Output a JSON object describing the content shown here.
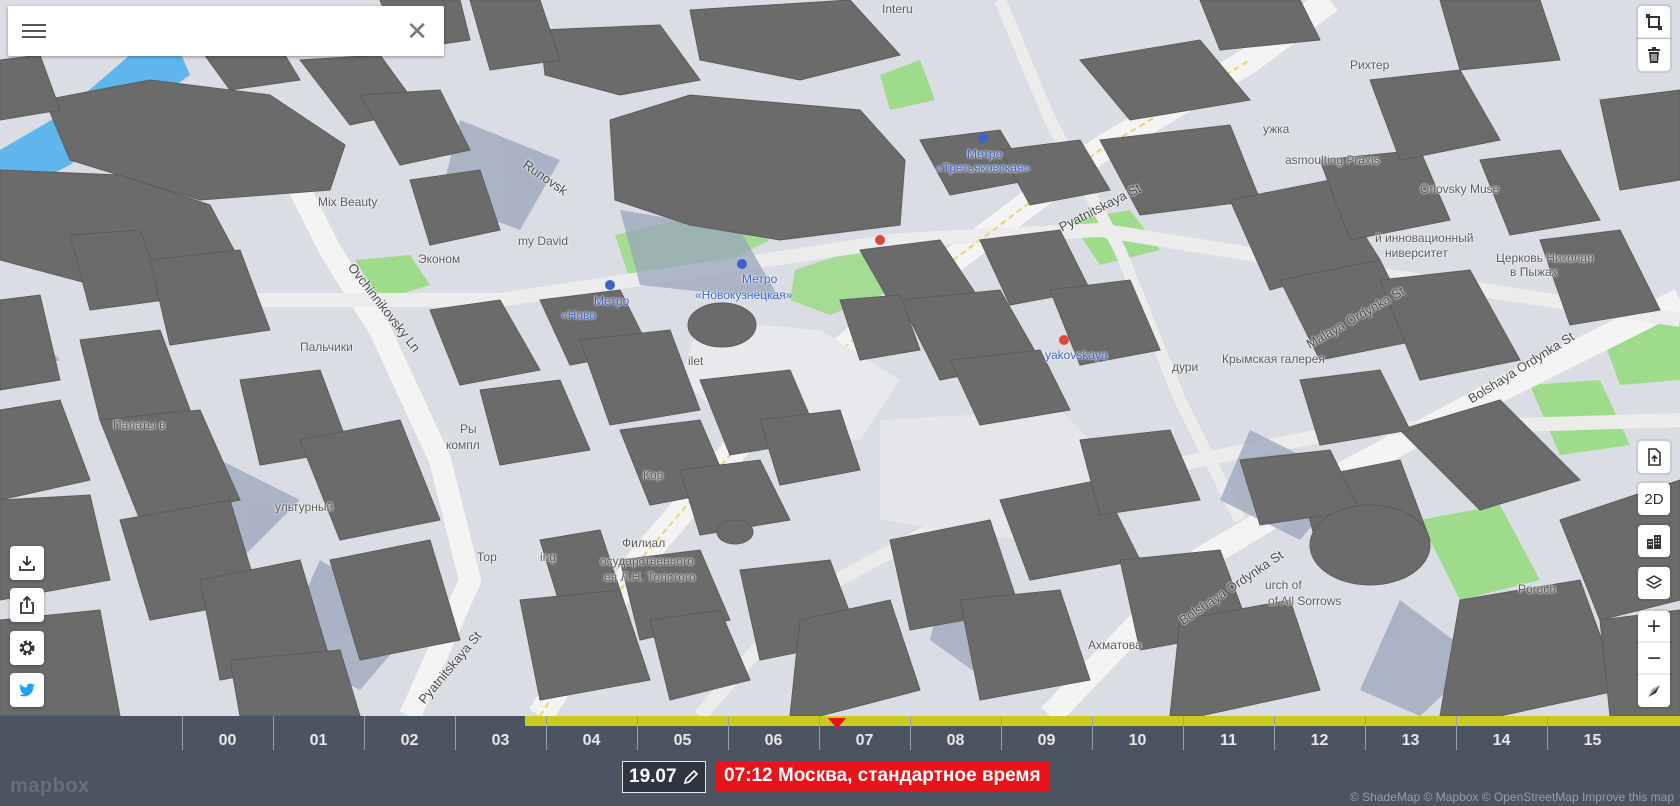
{
  "search": {
    "value": "",
    "placeholder": ""
  },
  "map_labels": {
    "metro": "Метро",
    "tretyakovskaya": "«Третьяковская»",
    "novokuznetskaya": "«Новокузнецкая»",
    "novo": "«Ново",
    "pyatnitskaya": "Pyatnitskaya St",
    "pyatnitskaya_top": "Pyatnitskaya St",
    "ovchinnikovsky": "Ovchinnikovsky Ln",
    "bolshaya_ordynka": "Bolshaya Ordynka St",
    "bolshaya_ordynka_right": "Bolshaya Ordynka St",
    "malaya_ordynka": "Malaya Ordynka St",
    "runovsk": "Runovsk",
    "mix_beauty": "Mix Beauty",
    "ekonom": "Эконом",
    "palchiki": "Пальчики",
    "palaty": "Палаты в",
    "filial": "Филиал",
    "gos_museum": "осударственного",
    "tolstoy": "ея Л.Н. Толстого",
    "akhmatova": "Ахматова",
    "krymskaya_gallery": "Крымская галерея",
    "yakovskaya": "yakovskaya",
    "church": "urch of",
    "all_sorrows": "of All Sorrows",
    "poruch": "Poruch",
    "univ": "ниверситет",
    "church_nik": "Церковь Николая",
    "v_pyzhah": "в Пыжах",
    "vasmoulting": "asmoulting Praxis",
    "rikhter": "Рихтер",
    "orlovsky": "Orlovsky Muse",
    "int_univ": "й инновационный",
    "my_david": "my David",
    "kultur": "ультурный",
    "tor": "Тор",
    "ing": "ing",
    "ilet": "ilet",
    "kor": "Кор",
    "duri": "дури",
    "ryb": "Ры",
    "kompl": "компл",
    "interu": "Interu",
    "uzhka": "ужка"
  },
  "right_controls": {
    "measure_icon": "square-selection-icon",
    "delete_icon": "trash-icon",
    "mode_2d": "2D",
    "zoom_in": "+",
    "zoom_out": "−"
  },
  "timeline": {
    "hours": [
      "00",
      "01",
      "02",
      "03",
      "04",
      "05",
      "06",
      "07",
      "08",
      "09",
      "10",
      "11",
      "12",
      "13",
      "14",
      "15"
    ],
    "date": "19.07",
    "time_label": "07:12 Москва, стандартное время",
    "marker_hour": 7.2,
    "daylight_start_hour": 3.77,
    "bar_color": "#c9cc1f",
    "marker_color": "#e8141b"
  },
  "attribution": "© ShadeMap © Mapbox © OpenStreetMap  Improve this map",
  "mapbox_logo": "mapbox"
}
